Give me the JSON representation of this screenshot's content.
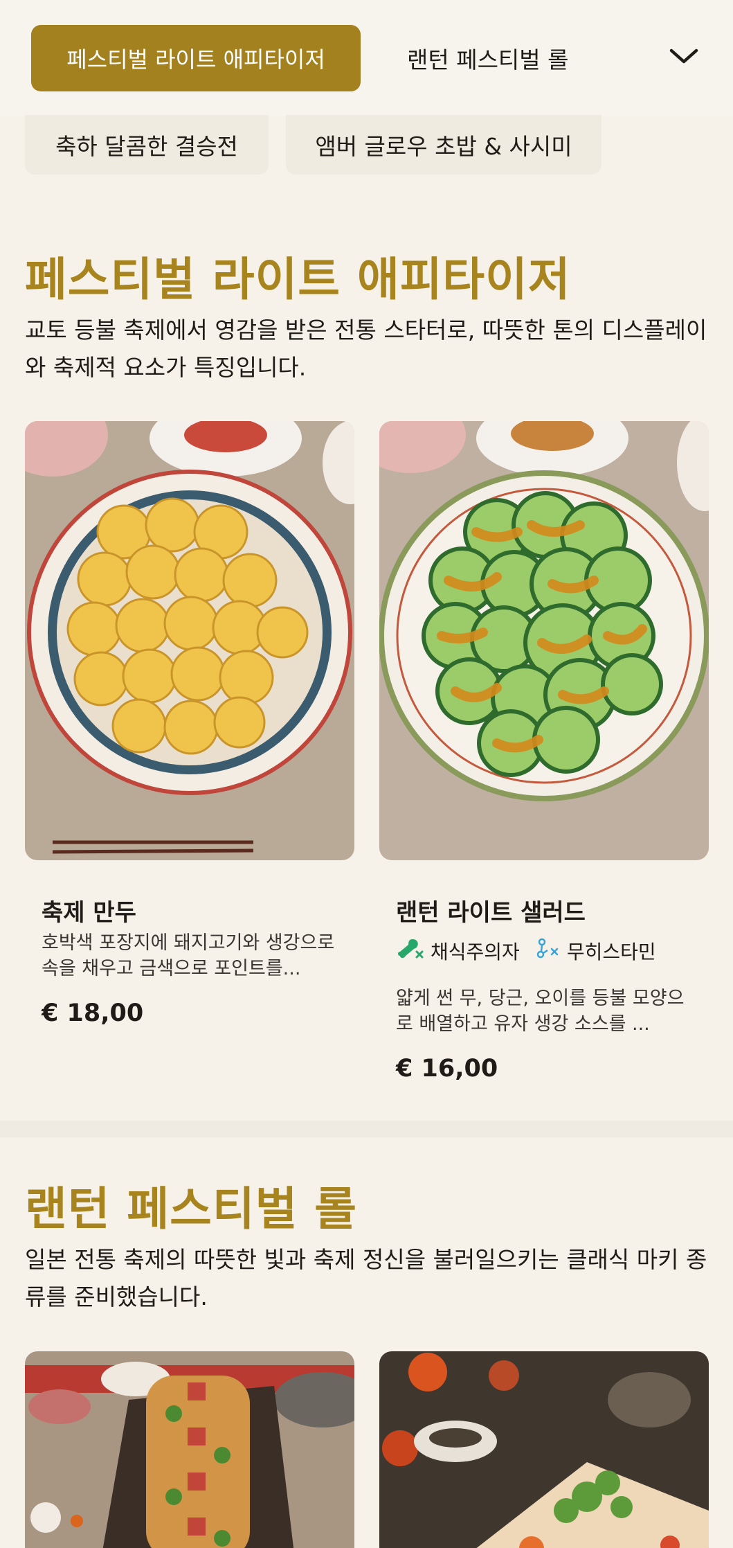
{
  "category_nav": {
    "active_label": "페스티벌 라이트 애피타이저",
    "second_label": "랜턴 페스티벌 롤",
    "chips": [
      "축하 달콤한 결승전",
      "앰버 글로우 초밥 & 사시미"
    ]
  },
  "sections": [
    {
      "title": "페스티벌 라이트 애피타이저",
      "description": "교토 등불 축제에서 영감을 받은 전통 스타터로, 따뜻한 톤의 디스플레이와 축제적 요소가 특징입니다.",
      "items": [
        {
          "name": "축제 만두",
          "description": "호박색 포장지에 돼지고기와 생강으로 속을 채우고 금색으로 포인트를...",
          "price": "€ 18,00"
        },
        {
          "name": "랜턴 라이트 샐러드",
          "tags": [
            "채식주의자",
            "무히스타민"
          ],
          "description": "얇게 썬 무, 당근, 오이를 등불 모양으로 배열하고 유자 생강 소스를 ...",
          "price": "€ 16,00"
        }
      ]
    },
    {
      "title": "랜턴 페스티벌 롤",
      "description": "일본 전통 축제의 따뜻한 빛과 축제 정신을 불러일으키는 클래식 마키 종류를 준비했습니다."
    }
  ],
  "colors": {
    "accent": "#a3811f",
    "title_gold": "#a8841f",
    "background": "#f6f2ea",
    "tag_green": "#27a86a",
    "tag_blue": "#3aa3d8"
  }
}
